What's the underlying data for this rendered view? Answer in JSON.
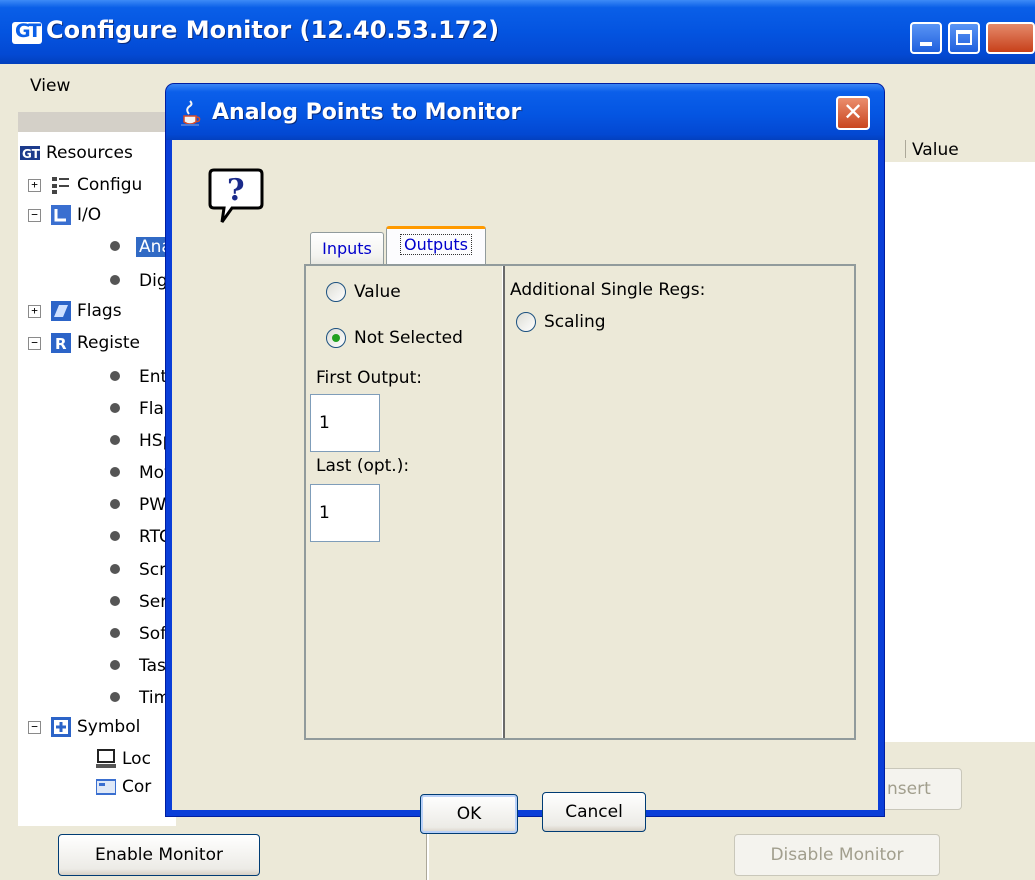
{
  "main_window": {
    "title": "Configure Monitor (12.40.53.172)",
    "menu": {
      "view": "View"
    },
    "tree": {
      "root": "Resources",
      "items": [
        {
          "label": "Configu",
          "expander": "+"
        },
        {
          "label": "I/O",
          "expander": "−"
        },
        {
          "label": "Ana",
          "selected": true
        },
        {
          "label": "Dig"
        },
        {
          "label": "Flags",
          "expander": "+"
        },
        {
          "label": "Registe",
          "expander": "−"
        },
        {
          "label": "Ent"
        },
        {
          "label": "Fla"
        },
        {
          "label": "HSp"
        },
        {
          "label": "Mot"
        },
        {
          "label": "PW"
        },
        {
          "label": "RTC"
        },
        {
          "label": "Scr"
        },
        {
          "label": "Ser"
        },
        {
          "label": "Sof"
        },
        {
          "label": "Tas"
        },
        {
          "label": "Tim"
        },
        {
          "label": "Symbol",
          "expander": "−"
        },
        {
          "label": "Loc"
        },
        {
          "label": "Cor"
        }
      ]
    },
    "table_header": {
      "value": "Value"
    },
    "buttons": {
      "enable_monitor": "Enable Monitor",
      "disable_monitor": "Disable Monitor",
      "insert": "nsert"
    }
  },
  "dialog": {
    "title": "Analog Points to Monitor",
    "tabs": {
      "inputs": "Inputs",
      "outputs": "Outputs",
      "active": "Outputs"
    },
    "options": {
      "value": "Value",
      "not_selected": "Not Selected",
      "selected_option": "Not Selected"
    },
    "first_output": {
      "label": "First Output:",
      "value": "1"
    },
    "last_output": {
      "label": "Last (opt.):",
      "value": "1"
    },
    "additional": {
      "heading": "Additional Single Regs:",
      "scaling": "Scaling"
    },
    "buttons": {
      "ok": "OK",
      "cancel": "Cancel"
    }
  },
  "colors": {
    "titlebar_blue": "#0454e0",
    "selection": "#316ac5",
    "tab_highlight": "#ff9a00",
    "radio_dot": "#21a121"
  }
}
